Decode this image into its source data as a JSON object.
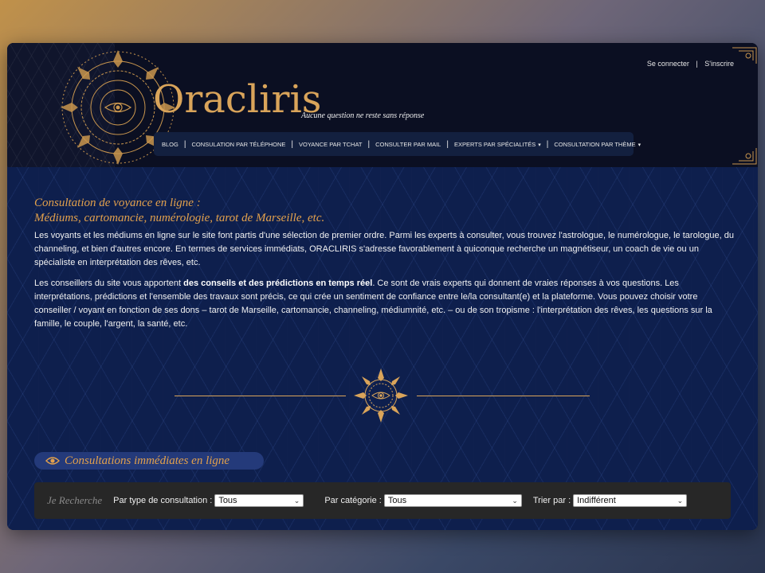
{
  "header": {
    "logo": "Oracliris",
    "tagline": "Aucune question ne reste sans réponse",
    "auth": {
      "login": "Se connecter",
      "separator": "|",
      "signup": "S'inscrire"
    }
  },
  "nav": {
    "items": [
      {
        "label": "BLOG"
      },
      {
        "label": "CONSULATION PAR TÉLÉPHONE"
      },
      {
        "label": "VOYANCE PAR TCHAT"
      },
      {
        "label": "CONSULTER PAR MAIL"
      },
      {
        "label": "EXPERTS PAR SPÉCIALITÉS",
        "dropdown": true
      },
      {
        "label": "CONSULTATION PAR THÈME",
        "dropdown": true
      }
    ],
    "caret": "▾",
    "separator": "|"
  },
  "main": {
    "heading_line1": "Consultation de voyance en ligne :",
    "heading_line2": "Médiums, cartomancie, numérologie, tarot de Marseille, etc.",
    "paragraph1": "Les voyants et les médiums en ligne sur le site font partis d'une sélection de premier ordre. Parmi les experts à consulter, vous trouvez l'astrologue, le numérologue, le tarologue, du channeling, et bien d'autres encore. En termes de services immédiats, ORACLIRIS s'adresse favorablement à quiconque recherche un magnétiseur, un coach de vie ou un spécialiste en interprétation des rêves, etc.",
    "paragraph2_before": "Les conseillers du site vous apportent ",
    "paragraph2_bold": "des conseils et des prédictions en temps réel",
    "paragraph2_after": ". Ce sont de vrais experts qui donnent de vraies réponses à vos questions. Les interprétations, prédictions et l'ensemble des travaux sont précis, ce qui crée un sentiment de confiance entre le/la consultant(e) et la plateforme. Vous pouvez choisir votre conseiller / voyant en fonction de ses dons – tarot de Marseille, cartomancie, channeling, médiumnité, etc. – ou de son tropisme : l'interprétation des rêves, les questions sur la famille, le couple, l'argent, la santé, etc."
  },
  "section": {
    "title": "Consultations immédiates en ligne",
    "icon": "eye-icon"
  },
  "filters": {
    "search_label": "Je Recherche",
    "type_label": "Par type de consultation :",
    "type_value": "Tous",
    "category_label": "Par catégorie :",
    "category_value": "Tous",
    "sort_label": "Trier par :",
    "sort_value": "Indifférent",
    "chevron": "⌄"
  },
  "colors": {
    "gold": "#d9a45a",
    "header_bg": "#0b0f22",
    "main_bg": "#0e1f4d",
    "filter_bg": "#272727"
  }
}
